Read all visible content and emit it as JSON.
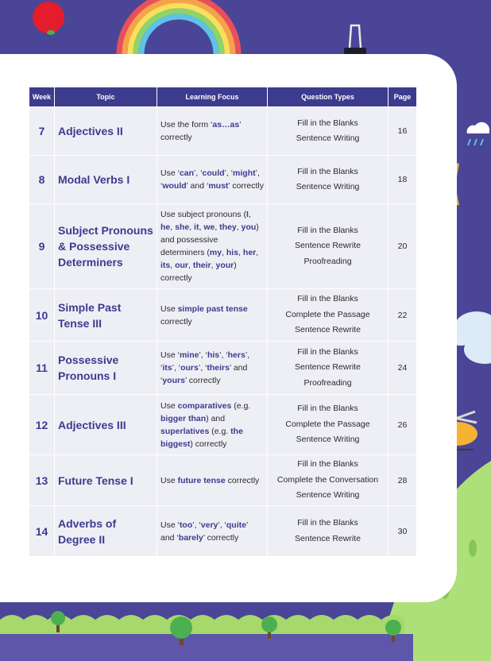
{
  "table": {
    "headers": {
      "week": "Week",
      "topic": "Topic",
      "focus": "Learning Focus",
      "qtypes": "Question Types",
      "page": "Page"
    },
    "rows": [
      {
        "week": "7",
        "topic": "Adjectives II",
        "focus": [
          {
            "t": "Use the form ‘"
          },
          {
            "t": "as…as",
            "b": 1
          },
          {
            "t": "’ correctly"
          }
        ],
        "qtypes": [
          "Fill in the Blanks",
          "Sentence Writing"
        ],
        "page": "16"
      },
      {
        "week": "8",
        "topic": "Modal Verbs I",
        "focus": [
          {
            "t": "Use ‘"
          },
          {
            "t": "can",
            "b": 1
          },
          {
            "t": "’, ‘"
          },
          {
            "t": "could",
            "b": 1
          },
          {
            "t": "’, ‘"
          },
          {
            "t": "might",
            "b": 1
          },
          {
            "t": "’, ‘"
          },
          {
            "t": "would",
            "b": 1
          },
          {
            "t": "’ and ‘"
          },
          {
            "t": "must",
            "b": 1
          },
          {
            "t": "’ correctly"
          }
        ],
        "qtypes": [
          "Fill in the Blanks",
          "Sentence Writing"
        ],
        "page": "18"
      },
      {
        "week": "9",
        "topic": "Subject Pronouns & Possessive Determiners",
        "focus": [
          {
            "t": "Use subject pronouns ("
          },
          {
            "t": "I",
            "b": 1
          },
          {
            "t": ", "
          },
          {
            "t": "he",
            "b": 1
          },
          {
            "t": ", "
          },
          {
            "t": "she",
            "b": 1
          },
          {
            "t": ", "
          },
          {
            "t": "it",
            "b": 1
          },
          {
            "t": ", "
          },
          {
            "t": "we",
            "b": 1
          },
          {
            "t": ", "
          },
          {
            "t": "they",
            "b": 1
          },
          {
            "t": ", "
          },
          {
            "t": "you",
            "b": 1
          },
          {
            "t": ") and possessive determiners ("
          },
          {
            "t": "my",
            "b": 1
          },
          {
            "t": ", "
          },
          {
            "t": "his",
            "b": 1
          },
          {
            "t": ", "
          },
          {
            "t": "her",
            "b": 1
          },
          {
            "t": ", "
          },
          {
            "t": "its",
            "b": 1
          },
          {
            "t": ", "
          },
          {
            "t": "our",
            "b": 1
          },
          {
            "t": ", "
          },
          {
            "t": "their",
            "b": 1
          },
          {
            "t": ", "
          },
          {
            "t": "your",
            "b": 1
          },
          {
            "t": ") correctly"
          }
        ],
        "qtypes": [
          "Fill in the Blanks",
          "Sentence Rewrite",
          "Proofreading"
        ],
        "page": "20"
      },
      {
        "week": "10",
        "topic": "Simple Past Tense III",
        "focus": [
          {
            "t": "Use "
          },
          {
            "t": "simple past tense",
            "b": 1
          },
          {
            "t": " correctly"
          }
        ],
        "qtypes": [
          "Fill in the Blanks",
          "Complete the Passage",
          "Sentence Rewrite"
        ],
        "page": "22"
      },
      {
        "week": "11",
        "topic": "Possessive Pronouns I",
        "focus": [
          {
            "t": "Use ‘"
          },
          {
            "t": "mine",
            "b": 1
          },
          {
            "t": "’, ‘"
          },
          {
            "t": "his",
            "b": 1
          },
          {
            "t": "’, ‘"
          },
          {
            "t": "hers",
            "b": 1
          },
          {
            "t": "’, ‘"
          },
          {
            "t": "its",
            "b": 1
          },
          {
            "t": "’, ‘"
          },
          {
            "t": "ours",
            "b": 1
          },
          {
            "t": "’, ‘"
          },
          {
            "t": "theirs",
            "b": 1
          },
          {
            "t": "’ and ‘"
          },
          {
            "t": "yours",
            "b": 1
          },
          {
            "t": "’ correctly"
          }
        ],
        "qtypes": [
          "Fill in the Blanks",
          "Sentence Rewrite",
          "Proofreading"
        ],
        "page": "24"
      },
      {
        "week": "12",
        "topic": "Adjectives III",
        "focus": [
          {
            "t": "Use "
          },
          {
            "t": "comparatives",
            "b": 1
          },
          {
            "t": " (e.g. "
          },
          {
            "t": "bigger than",
            "b": 1
          },
          {
            "t": ") and "
          },
          {
            "t": "superlatives",
            "b": 1
          },
          {
            "t": " (e.g. "
          },
          {
            "t": "the biggest",
            "b": 1
          },
          {
            "t": ") correctly"
          }
        ],
        "qtypes": [
          "Fill in the Blanks",
          "Complete the Passage",
          "Sentence Writing"
        ],
        "page": "26"
      },
      {
        "week": "13",
        "topic": "Future Tense I",
        "focus": [
          {
            "t": "Use "
          },
          {
            "t": "future tense",
            "b": 1
          },
          {
            "t": " correctly"
          }
        ],
        "qtypes": [
          "Fill in the Blanks",
          "Complete the Conversation",
          "Sentence Writing"
        ],
        "page": "28"
      },
      {
        "week": "14",
        "topic": "Adverbs of Degree II",
        "focus": [
          {
            "t": "Use ‘"
          },
          {
            "t": "too",
            "b": 1
          },
          {
            "t": "’, ‘"
          },
          {
            "t": "very",
            "b": 1
          },
          {
            "t": "’, ‘"
          },
          {
            "t": "quite",
            "b": 1
          },
          {
            "t": "’ and ‘"
          },
          {
            "t": "barely",
            "b": 1
          },
          {
            "t": "’ correctly"
          }
        ],
        "qtypes": [
          "Fill in the Blanks",
          "Sentence Rewrite"
        ],
        "page": "30"
      }
    ]
  },
  "colors": {
    "background": "#4a4597",
    "header": "#3d3b8e",
    "cell": "#eeeef5",
    "accent_text": "#3d3b8e",
    "grass": "#a6d86c"
  },
  "icons": [
    "apple-icon",
    "rainbow-icon",
    "binder-clip-icon",
    "gem-icon",
    "rain-cloud-icon",
    "cloud-icon",
    "helicopter-icon",
    "tree-icon",
    "hill-icon",
    "striped-tail-icon"
  ]
}
